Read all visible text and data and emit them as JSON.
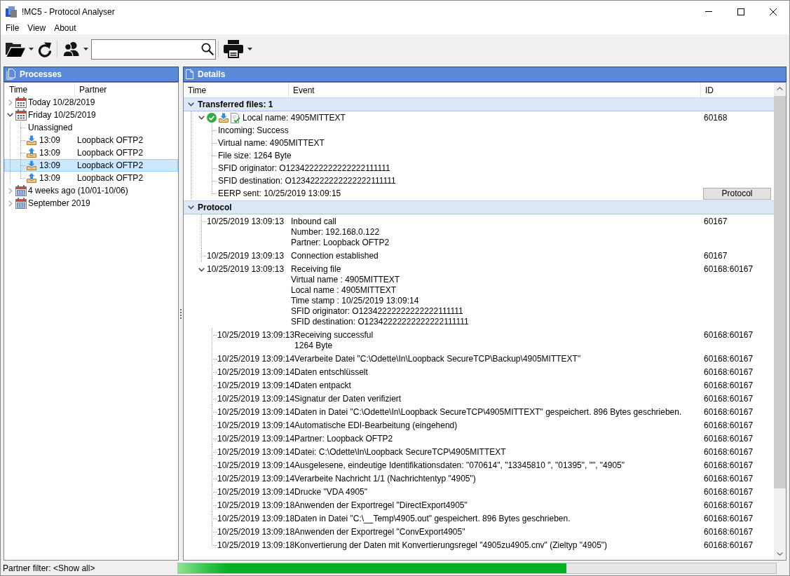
{
  "window": {
    "title": "!MC5 - Protocol Analyser"
  },
  "menu": [
    "File",
    "View",
    "About"
  ],
  "processes": {
    "title": "Processes",
    "columns": [
      "Time",
      "Partner"
    ],
    "tree": [
      {
        "kind": "day",
        "label": "Today 10/28/2019",
        "expanded": false,
        "selected": false
      },
      {
        "kind": "day",
        "label": "Friday 10/25/2019",
        "expanded": true,
        "selected": false,
        "children": [
          {
            "kind": "group",
            "label": "Unassigned",
            "selected": false
          },
          {
            "kind": "transfer",
            "incoming": true,
            "time": "13:09",
            "partner": "Loopback OFTP2",
            "selected": false
          },
          {
            "kind": "transfer",
            "incoming": false,
            "time": "13:09",
            "partner": "Loopback OFTP2",
            "selected": false
          },
          {
            "kind": "transfer",
            "incoming": true,
            "time": "13:09",
            "partner": "Loopback OFTP2",
            "selected": true
          },
          {
            "kind": "transfer",
            "incoming": false,
            "time": "13:09",
            "partner": "Loopback OFTP2",
            "selected": false
          }
        ]
      },
      {
        "kind": "period",
        "label": "4 weeks ago (10/01-10/06)",
        "expanded": false,
        "selected": false
      },
      {
        "kind": "period",
        "label": "September 2019",
        "expanded": false,
        "selected": false
      }
    ]
  },
  "details": {
    "title": "Details",
    "columns": [
      "Time",
      "Event",
      "ID"
    ],
    "sections": [
      {
        "kind": "section",
        "title": "Transferred files: 1",
        "expanded": true,
        "children": [
          {
            "kind": "file",
            "succeeded": true,
            "incoming": true,
            "label": "Local name: 4905MITTEXT",
            "id": "60168",
            "expanded": true,
            "children": [
              {
                "kind": "property",
                "label": "Incoming: Success"
              },
              {
                "kind": "property",
                "label": "Virtual name: 4905MITTEXT"
              },
              {
                "kind": "property",
                "label": "File size: 1264 Byte"
              },
              {
                "kind": "property",
                "label": "SFID originator: O12342222222222222111111"
              },
              {
                "kind": "property",
                "label": "SFID destination: O12342222222222222111111"
              },
              {
                "kind": "property",
                "label": "EERP sent: 10/25/2019 13:09:15",
                "button": "Protocol"
              }
            ]
          }
        ]
      },
      {
        "kind": "section",
        "title": "Protocol",
        "expanded": true,
        "children": [
          {
            "kind": "log",
            "time": "10/25/2019 13:09:13",
            "lines": [
              "Inbound call",
              "Number: 192.168.0.122",
              "Partner: Loopback OFTP2"
            ],
            "id": "60167"
          },
          {
            "kind": "log",
            "time": "10/25/2019 13:09:13",
            "lines": [
              "Connection established"
            ],
            "id": "60167"
          },
          {
            "kind": "log",
            "time": "10/25/2019 13:09:13",
            "lines": [
              "Receiving file",
              "Virtual name : 4905MITTEXT",
              "Local name : 4905MITTEXT",
              "Time stamp : 10/25/2019 13:09:14",
              "SFID originator: O12342222222222222111111",
              "SFID destination: O12342222222222222111111"
            ],
            "id": "60168:60167",
            "expanded": true,
            "children": [
              {
                "kind": "log",
                "time": "10/25/2019 13:09:13",
                "lines": [
                  "Receiving successful",
                  "1264 Byte"
                ],
                "id": "60168:60167"
              },
              {
                "kind": "log",
                "time": "10/25/2019 13:09:14",
                "lines": [
                  "Verarbeite Datei \"C:\\Odette\\In\\Loopback SecureTCP\\Backup\\4905MITTEXT\""
                ],
                "id": "60168:60167"
              },
              {
                "kind": "log",
                "time": "10/25/2019 13:09:14",
                "lines": [
                  "Daten entschlüsselt"
                ],
                "id": "60168:60167"
              },
              {
                "kind": "log",
                "time": "10/25/2019 13:09:14",
                "lines": [
                  "Daten entpackt"
                ],
                "id": "60168:60167"
              },
              {
                "kind": "log",
                "time": "10/25/2019 13:09:14",
                "lines": [
                  "Signatur der Daten verifiziert"
                ],
                "id": "60168:60167"
              },
              {
                "kind": "log",
                "time": "10/25/2019 13:09:14",
                "lines": [
                  "Daten in Datei \"C:\\Odette\\In\\Loopback SecureTCP\\4905MITTEXT\" gespeichert. 896 Bytes geschrieben."
                ],
                "id": "60168:60167"
              },
              {
                "kind": "log",
                "time": "10/25/2019 13:09:14",
                "lines": [
                  "Automatische EDI-Bearbeitung (eingehend)"
                ],
                "id": "60168:60167"
              },
              {
                "kind": "log",
                "time": "10/25/2019 13:09:14",
                "lines": [
                  "Partner: Loopback OFTP2"
                ],
                "id": "60168:60167"
              },
              {
                "kind": "log",
                "time": "10/25/2019 13:09:14",
                "lines": [
                  "Datei: C:\\Odette\\In\\Loopback SecureTCP\\4905MITTEXT"
                ],
                "id": "60168:60167"
              },
              {
                "kind": "log",
                "time": "10/25/2019 13:09:14",
                "lines": [
                  "Ausgelesene, eindeutige Identifikationsdaten: \"070614\", \"13345810 \", \"01395\", \"\", \"4905\""
                ],
                "id": "60168:60167"
              },
              {
                "kind": "log",
                "time": "10/25/2019 13:09:14",
                "lines": [
                  "Verarbeite Nachricht 1/1 (Nachrichtentyp \"4905\")"
                ],
                "id": "60168:60167"
              },
              {
                "kind": "log",
                "time": "10/25/2019 13:09:14",
                "lines": [
                  "Drucke \"VDA 4905\""
                ],
                "id": "60168:60167"
              },
              {
                "kind": "log",
                "time": "10/25/2019 13:09:18",
                "lines": [
                  "Anwenden der Exportregel \"DirectExport4905\""
                ],
                "id": "60168:60167"
              },
              {
                "kind": "log",
                "time": "10/25/2019 13:09:18",
                "lines": [
                  "Daten in Datei \"C:\\__Temp\\4905.out\" gespeichert. 896 Bytes geschrieben."
                ],
                "id": "60168:60167"
              },
              {
                "kind": "log",
                "time": "10/25/2019 13:09:18",
                "lines": [
                  "Anwenden der Exportregel \"ConvExport4905\""
                ],
                "id": "60168:60167"
              },
              {
                "kind": "log",
                "time": "10/25/2019 13:09:18",
                "lines": [
                  "Konvertierung der Daten mit Konvertierungsregel \"4905zu4905.cnv\" (Zieltyp \"4905\")"
                ],
                "id": "60168:60167"
              }
            ]
          }
        ]
      }
    ]
  },
  "status_bar": {
    "text": "Partner filter: <Show all>",
    "progress": {
      "level": 0.65
    }
  }
}
